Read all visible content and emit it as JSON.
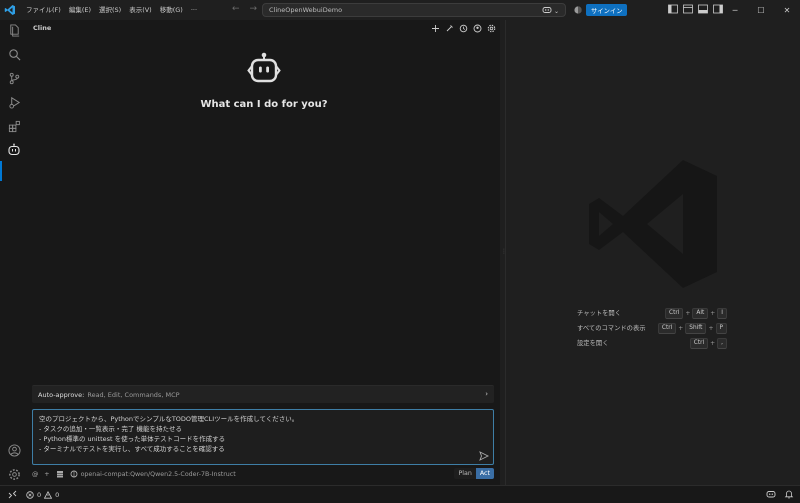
{
  "titlebar": {
    "menu": [
      "ファイル(F)",
      "編集(E)",
      "選択(S)",
      "表示(V)",
      "移動(G)",
      "···"
    ],
    "search_text": "ClineOpenWebuiDemo",
    "signin_label": "サインイン"
  },
  "sidebar": {
    "title": "Cline",
    "hero_text": "What can I do for you?",
    "auto_approve": {
      "label": "Auto-approve:",
      "values": "Read, Edit, Commands, MCP"
    },
    "prompt_lines": [
      "空のプロジェクトから、PythonでシンプルなTODO管理CLIツールを作成してください。",
      "- タスクの追加・一覧表示・完了 機能を持たせる",
      "- Python標準の unittest を使った単体テストコードを作成する",
      "- ターミナルでテストを実行し、すべて成功することを確認する"
    ],
    "bottom": {
      "at": "@",
      "plus": "+",
      "model": "openai-compat:Qwen/Qwen2.5-Coder-7B-Instruct",
      "plan_label": "Plan",
      "act_label": "Act"
    }
  },
  "editor": {
    "shortcuts": [
      {
        "label": "チャットを開く",
        "keys": [
          "Ctrl",
          "Alt",
          "I"
        ]
      },
      {
        "label": "すべてのコマンドの表示",
        "keys": [
          "Ctrl",
          "Shift",
          "P"
        ]
      },
      {
        "label": "設定を開く",
        "keys": [
          "Ctrl",
          ","
        ]
      }
    ]
  },
  "statusbar": {
    "errors": "0",
    "warnings": "0"
  },
  "colors": {
    "accent": "#0078d4",
    "signin_bg": "#0e70c0",
    "act_bg": "#3a6ea5",
    "prompt_border": "#3e7ea6"
  }
}
